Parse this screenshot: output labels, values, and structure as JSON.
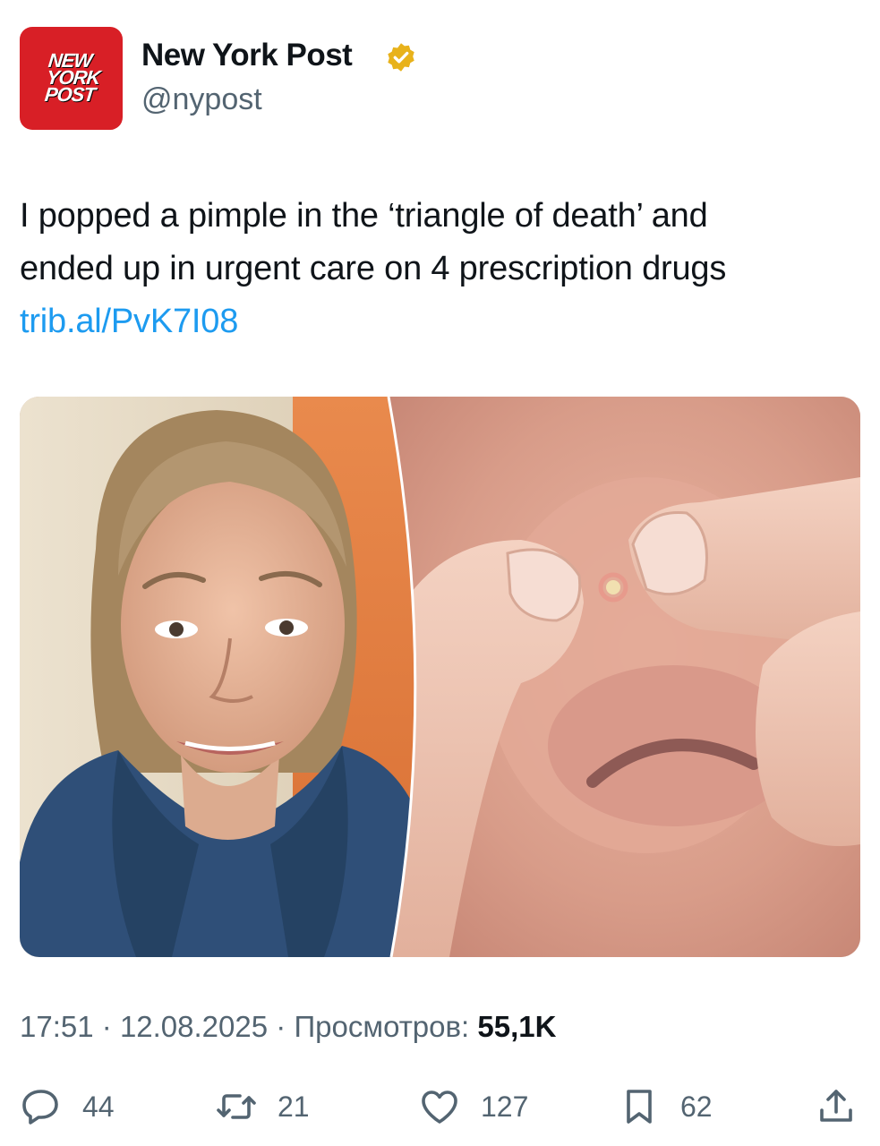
{
  "author": {
    "avatar_lines": [
      "NEW",
      "YORK",
      "POST"
    ],
    "name": "New York Post",
    "handle": "@nypost",
    "verified": true,
    "verified_badge_color": "#e8b21b"
  },
  "tweet": {
    "text_lines": [
      "I popped a pimple in the ‘triangle of death’ and",
      "ended up in urgent care on 4 prescription drugs"
    ],
    "link": "trib.al/PvK7I08"
  },
  "media": {
    "panels": [
      "woman-selfie-photo",
      "nose-pimple-closeup-photo"
    ]
  },
  "meta": {
    "time": "17:51",
    "date": "12.08.2025",
    "views_label": "Просмотров:",
    "views_count": "55,1K"
  },
  "actions": {
    "reply": {
      "icon": "reply-icon",
      "count": "44"
    },
    "retweet": {
      "icon": "retweet-icon",
      "count": "21"
    },
    "like": {
      "icon": "heart-icon",
      "count": "127"
    },
    "bookmark": {
      "icon": "bookmark-icon",
      "count": "62"
    },
    "share": {
      "icon": "share-icon"
    }
  },
  "colors": {
    "brand_red": "#d81f26",
    "link_blue": "#1d9bf0",
    "secondary_text": "#536471",
    "primary_text": "#0f1419"
  }
}
